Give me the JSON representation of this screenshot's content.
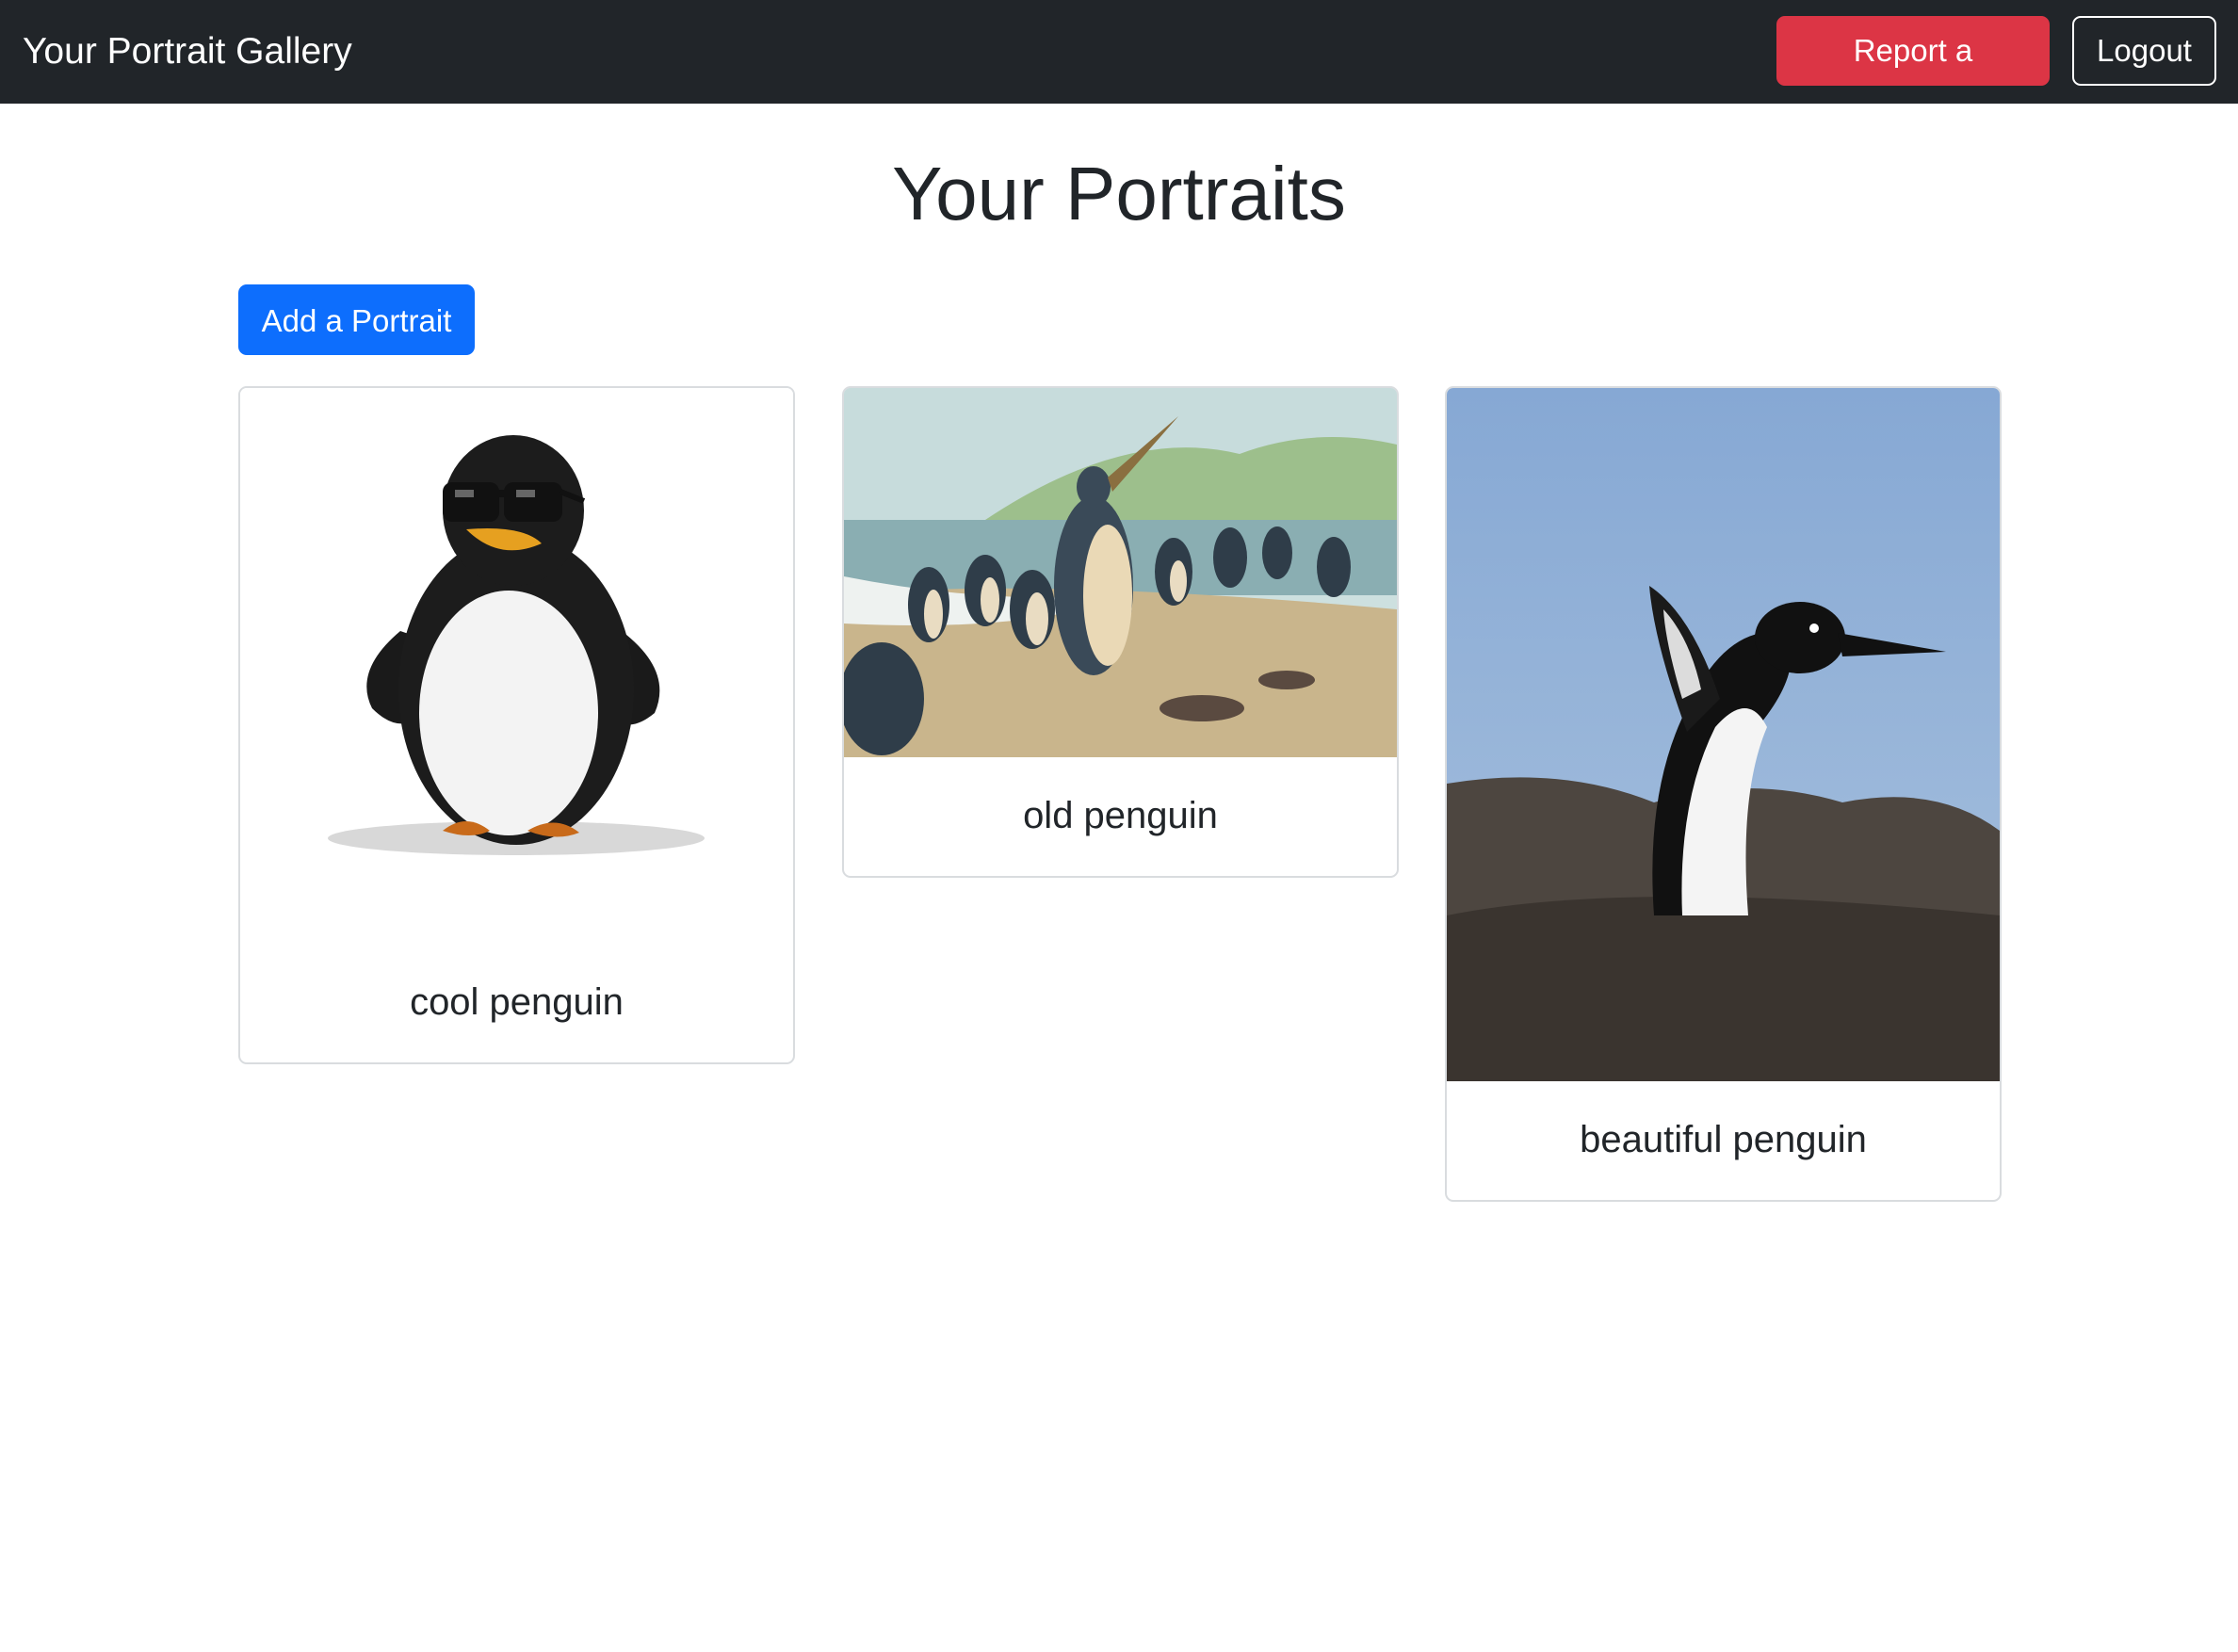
{
  "navbar": {
    "brand": "Your Portrait Gallery",
    "report_label": "Report a Portrait",
    "logout_label": "Logout"
  },
  "main": {
    "title": "Your Portraits",
    "add_label": "Add a Portrait",
    "portraits": [
      {
        "caption": "cool penguin",
        "image": "cartoon penguin wearing sunglasses"
      },
      {
        "caption": "old penguin",
        "image": "painting of prehistoric penguins on a beach"
      },
      {
        "caption": "beautiful penguin",
        "image": "photo of adelie penguin on rocks"
      }
    ]
  },
  "colors": {
    "navbar_bg": "#212529",
    "report_button": "#dc3545",
    "add_button": "#0d6efd"
  }
}
